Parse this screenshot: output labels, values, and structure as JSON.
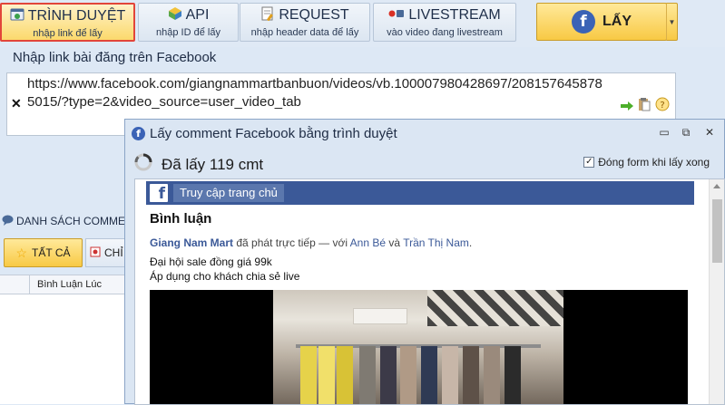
{
  "toolbar": {
    "buttons": [
      {
        "title": "TRÌNH DUYỆT",
        "subtitle": "nhập link để lấy",
        "icon": "browser-globe-icon",
        "active": true
      },
      {
        "title": "API",
        "subtitle": "nhập ID để lấy",
        "icon": "cube-icon",
        "active": false
      },
      {
        "title": "REQUEST",
        "subtitle": "nhập header data để lấy",
        "icon": "document-edit-icon",
        "active": false
      },
      {
        "title": "LIVESTREAM",
        "subtitle": "vào video đang livestream",
        "icon": "live-record-icon",
        "active": false
      }
    ],
    "get_button": {
      "label": "LẤY",
      "icon": "facebook-bubble-icon"
    }
  },
  "link_panel": {
    "label": "Nhập link bài đăng trên Facebook",
    "url": "https://www.facebook.com/giangnammartbanbuon/videos/vb.100007980428697/2081576458785015/?type=2&video_source=user_video_tab"
  },
  "comment_list": {
    "header": "DANH SÁCH COMMENT",
    "all_button": "TẤT CẢ",
    "filter_button": "CHỈ",
    "column_time": "Bình Luận Lúc"
  },
  "dialog": {
    "title": "Lấy comment Facebook bằng trình duyệt",
    "status": "Đã lấy 119 cmt",
    "close_form_checkbox": {
      "label": "Đóng form khi lấy xong",
      "checked": true
    },
    "page": {
      "home_link": "Truy cập trang chủ",
      "section_title": "Bình luận",
      "author": "Giang Nam Mart",
      "live_text": "đã phát trực tiếp — với",
      "tagged_1": "Ann Bé",
      "conj": "và",
      "tagged_2": "Trần Thị Nam",
      "period": ".",
      "line1": "Đại hội sale đồng giá 99k",
      "line2": "Áp dụng cho khách chia sẻ live"
    }
  },
  "colors": {
    "facebook_blue": "#3b5998",
    "accent_gold": "#f8c944",
    "active_border": "#e2453a"
  }
}
